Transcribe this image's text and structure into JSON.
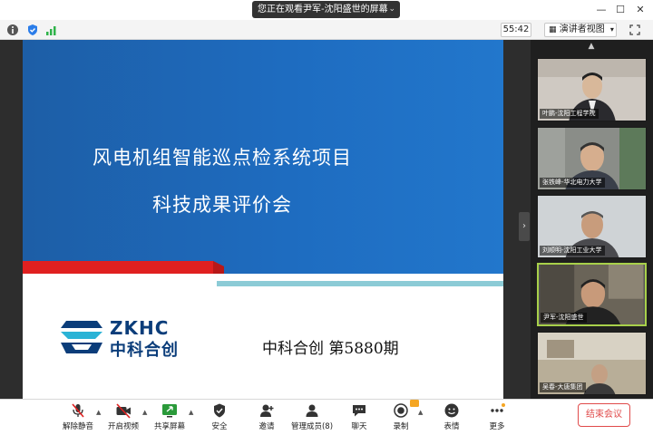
{
  "titlebar": {
    "share_banner": "您正在观看尹军-沈阳盛世的屏幕",
    "controls": [
      "minimize",
      "maximize",
      "close"
    ]
  },
  "infobar": {
    "timer": "55:42",
    "view_mode": "演讲者视图"
  },
  "slide": {
    "title_line1": "风电机组智能巡点检系统项目",
    "title_line2": "科技成果评价会",
    "logo_en": "ZKHC",
    "logo_cn": "中科合创",
    "footer": "中科合创    第5880期",
    "colors": {
      "blue": "#1e6cc0",
      "red": "#e02020",
      "teal": "#8ccbd6",
      "logo": "#0b3d7a"
    }
  },
  "participants": [
    {
      "name": "叶鹏-沈阳工程学院",
      "bg": "#cfc9c2"
    },
    {
      "name": "张铁峰-华北电力大学",
      "bg": "#8a8d88"
    },
    {
      "name": "刘顺明-沈阳工业大学",
      "bg": "#cfd3d6"
    },
    {
      "name": "尹军-沈阳盛世",
      "bg": "#6a6458",
      "active": true
    },
    {
      "name": "吴春-大唐集团",
      "bg": "#b8ae98"
    }
  ],
  "toolbar": {
    "items": [
      {
        "label": "解除静音",
        "icon": "mic-muted-icon"
      },
      {
        "label": "开启视频",
        "icon": "video-off-icon"
      },
      {
        "label": "共享屏幕",
        "icon": "share-screen-icon"
      },
      {
        "label": "安全",
        "icon": "shield-icon"
      },
      {
        "label": "邀请",
        "icon": "invite-icon"
      },
      {
        "label": "管理成员(8)",
        "icon": "participants-icon"
      },
      {
        "label": "聊天",
        "icon": "chat-icon"
      },
      {
        "label": "录制",
        "icon": "record-icon"
      },
      {
        "label": "表情",
        "icon": "emoji-icon"
      },
      {
        "label": "更多",
        "icon": "more-icon"
      }
    ],
    "end_label": "结束会议"
  }
}
